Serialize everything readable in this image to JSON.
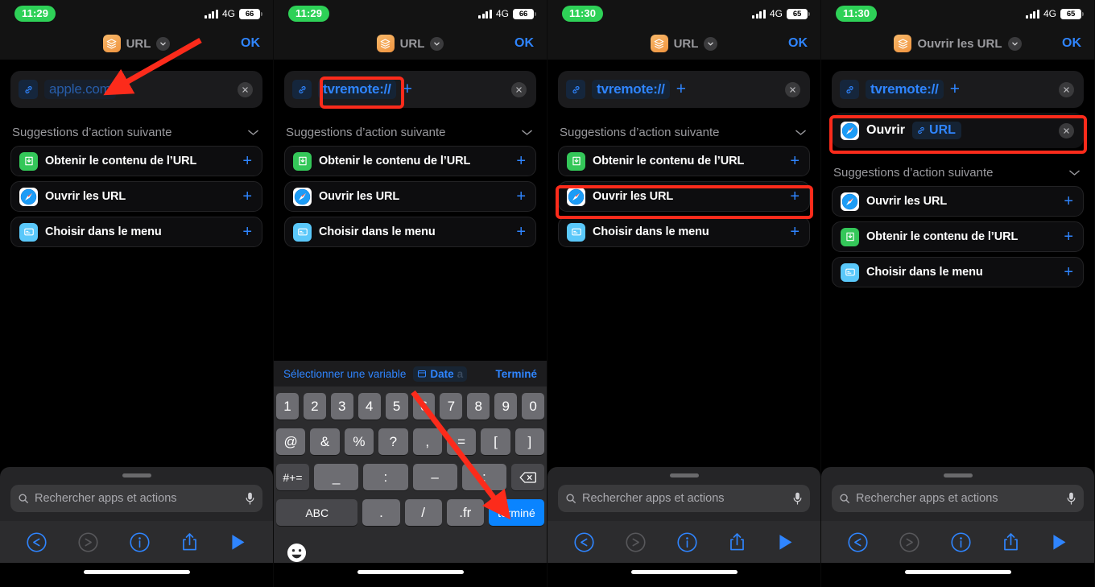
{
  "panels": [
    {
      "id": "panel-1",
      "status": {
        "time": "11:29",
        "network": "4G",
        "battery": "66"
      },
      "nav": {
        "title": "URL",
        "ok": "OK"
      },
      "url_field": {
        "value": "apple.com",
        "is_placeholder": true,
        "show_plus": false
      },
      "action_card": null,
      "section": {
        "title": "Suggestions d’action suivante"
      },
      "suggestions": [
        {
          "label": "Obtenir le contenu de l’URL",
          "icon": "download-green-icon",
          "add": "+"
        },
        {
          "label": "Ouvrir les URL",
          "icon": "safari-icon",
          "add": "+"
        },
        {
          "label": "Choisir dans le menu",
          "icon": "menu-blue-icon",
          "add": "+"
        }
      ],
      "bottom": {
        "type": "sheet",
        "search_placeholder": "Rechercher apps et actions"
      },
      "toolbar": {
        "undo": "undo-icon",
        "redo": "redo-icon",
        "info": "info-icon",
        "share": "share-icon",
        "play": "play-icon"
      },
      "highlight": null
    },
    {
      "id": "panel-2",
      "status": {
        "time": "11:29",
        "network": "4G",
        "battery": "66"
      },
      "nav": {
        "title": "URL",
        "ok": "OK"
      },
      "url_field": {
        "value": "tvremote://",
        "is_placeholder": false,
        "show_plus": true
      },
      "action_card": null,
      "section": {
        "title": "Suggestions d’action suivante"
      },
      "suggestions": [
        {
          "label": "Obtenir le contenu de l’URL",
          "icon": "download-green-icon",
          "add": "+"
        },
        {
          "label": "Ouvrir les URL",
          "icon": "safari-icon",
          "add": "+"
        },
        {
          "label": "Choisir dans le menu",
          "icon": "menu-blue-icon",
          "add": "+"
        }
      ],
      "bottom": {
        "type": "keyboard"
      },
      "highlight": "url-token"
    },
    {
      "id": "panel-3",
      "status": {
        "time": "11:30",
        "network": "4G",
        "battery": "65"
      },
      "nav": {
        "title": "URL",
        "ok": "OK"
      },
      "url_field": {
        "value": "tvremote://",
        "is_placeholder": false,
        "show_plus": true
      },
      "action_card": null,
      "section": {
        "title": "Suggestions d’action suivante"
      },
      "suggestions": [
        {
          "label": "Obtenir le contenu de l’URL",
          "icon": "download-green-icon",
          "add": "+"
        },
        {
          "label": "Ouvrir les URL",
          "icon": "safari-icon",
          "add": "+"
        },
        {
          "label": "Choisir dans le menu",
          "icon": "menu-blue-icon",
          "add": "+"
        }
      ],
      "bottom": {
        "type": "sheet",
        "search_placeholder": "Rechercher apps et actions"
      },
      "highlight": "suggestion-2"
    },
    {
      "id": "panel-4",
      "status": {
        "time": "11:30",
        "network": "4G",
        "battery": "65"
      },
      "nav": {
        "title": "Ouvrir les URL",
        "ok": "OK"
      },
      "url_field": {
        "value": "tvremote://",
        "is_placeholder": false,
        "show_plus": true
      },
      "action_card": {
        "label": "Ouvrir",
        "variable": "URL",
        "icon": "safari-icon"
      },
      "section": {
        "title": "Suggestions d’action suivante"
      },
      "suggestions": [
        {
          "label": "Ouvrir les URL",
          "icon": "safari-icon",
          "add": "+"
        },
        {
          "label": "Obtenir le contenu de l’URL",
          "icon": "download-green-icon",
          "add": "+"
        },
        {
          "label": "Choisir dans le menu",
          "icon": "menu-blue-icon",
          "add": "+"
        }
      ],
      "bottom": {
        "type": "sheet",
        "search_placeholder": "Rechercher apps et actions"
      },
      "highlight": "action-card"
    }
  ],
  "keyboard": {
    "toolbar": {
      "select_variable": "Sélectionner une variable",
      "variable_chip": "Date",
      "variable_chip_tail": "a",
      "done": "Terminé"
    },
    "row_numbers": [
      "1",
      "2",
      "3",
      "4",
      "5",
      "6",
      "7",
      "8",
      "9",
      "0"
    ],
    "row_symbols": [
      "@",
      "&",
      "%",
      "?",
      ",",
      "=",
      "[",
      "]"
    ],
    "row_alt": [
      "#+=",
      "_",
      ":",
      "–",
      ";"
    ],
    "backspace": "backspace-icon",
    "row_bottom": [
      "ABC",
      ".",
      "/",
      ".fr"
    ],
    "return_key": "terminé",
    "emoji": "emoji-icon"
  },
  "colors": {
    "accent_blue": "#2f85ff",
    "annotation_red": "#fc2b1b",
    "status_green": "#2ed157",
    "icon_green": "#34c759",
    "icon_lightblue": "#5ac8fa",
    "shortcuts_orange": "#f0943f",
    "key_blue": "#0a84ff"
  }
}
